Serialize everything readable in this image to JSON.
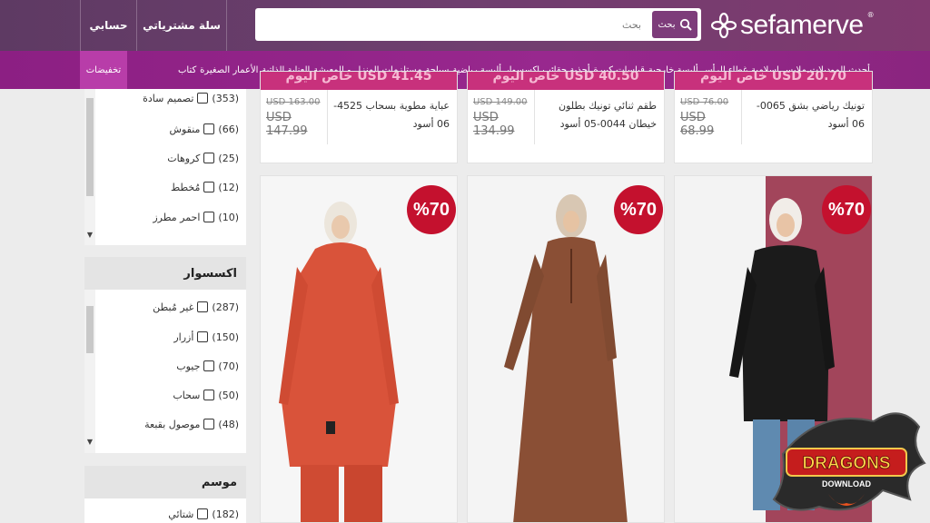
{
  "header": {
    "account_label": "حسابي",
    "cart_label": "سلة مشترياتي",
    "search_placeholder": "بحث",
    "search_button_label": "بحث",
    "logo_text": "sefamerve",
    "logo_mark": "®"
  },
  "nav": {
    "discount_label": "تخفيضات",
    "items": [
      "أحدث الموديلات",
      "ملابس اسلامية",
      "غطاء الرأس",
      "ألبسة خارجية",
      "قياسات كبيرة",
      "أحذية حقائب اكسسوار",
      "ألبسة رياضية",
      "سباحة",
      "مستلزمات المنزل و المعيشة",
      "العناية الذاتية",
      "الأعمار الصغيرة",
      "كتاب"
    ]
  },
  "filters": {
    "pattern_options": [
      {
        "label": "تصميم سادة",
        "count": "(353)"
      },
      {
        "label": "منقوش",
        "count": "(66)"
      },
      {
        "label": "كروهات",
        "count": "(25)"
      },
      {
        "label": "مُخطط",
        "count": "(12)"
      },
      {
        "label": "احمر مطرز",
        "count": "(10)"
      }
    ],
    "accessory_heading": "اكسسوار",
    "accessory_options": [
      {
        "label": "غير مُبطن",
        "count": "(287)"
      },
      {
        "label": "أزرار",
        "count": "(150)"
      },
      {
        "label": "جيوب",
        "count": "(70)"
      },
      {
        "label": "سحاب",
        "count": "(50)"
      },
      {
        "label": "موصول بقبعة",
        "count": "(48)"
      }
    ],
    "season_heading": "موسم",
    "season_options": [
      {
        "label": "شتائي",
        "count": "(182)"
      }
    ]
  },
  "products_top": [
    {
      "banner": "خاص اليوم USD 41.45",
      "name": "عباية مطوية بسحاب 4525-06 أسود",
      "old_price": "USD 163.00",
      "new_price": "USD 147.99"
    },
    {
      "banner": "خاص اليوم USD 40.50",
      "name": "طقم ثنائي تونيك بطلون خيطان 0044-05 أسود",
      "old_price": "USD 149.00",
      "new_price": "USD 134.99"
    },
    {
      "banner": "خاص اليوم USD 20.70",
      "name": "تونيك رياضي بشق 0065-06 أسود",
      "old_price": "USD 76.00",
      "new_price": "USD 68.99"
    }
  ],
  "products_bottom": [
    {
      "badge": "%70"
    },
    {
      "badge": "%70"
    },
    {
      "badge": "%70"
    }
  ],
  "watermark": {
    "line1": "DRAGONS",
    "line2": "DOWNLOAD"
  }
}
